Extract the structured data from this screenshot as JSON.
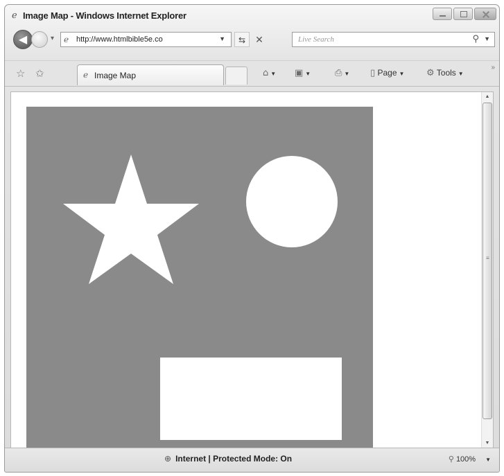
{
  "window": {
    "title": "Image Map - Windows Internet Explorer"
  },
  "address_bar": {
    "url": "http://www.htmlbible5e.co"
  },
  "search": {
    "placeholder": "Live Search"
  },
  "tab": {
    "label": "Image Map"
  },
  "toolbar": {
    "page_label": "Page",
    "tools_label": "Tools"
  },
  "statusbar": {
    "zone_text": "Internet | Protected Mode: On",
    "zoom": "100%"
  },
  "icons": [
    "ie-icon",
    "back-icon",
    "forward-icon",
    "refresh-icon",
    "stop-icon",
    "search-icon",
    "favorites-star-icon",
    "add-favorites-icon",
    "home-icon",
    "feeds-icon",
    "print-icon",
    "page-icon",
    "tools-icon",
    "globe-icon",
    "zoom-icon"
  ],
  "colors": {
    "map_background": "#8a8a8a",
    "shapes": "#ffffff"
  }
}
